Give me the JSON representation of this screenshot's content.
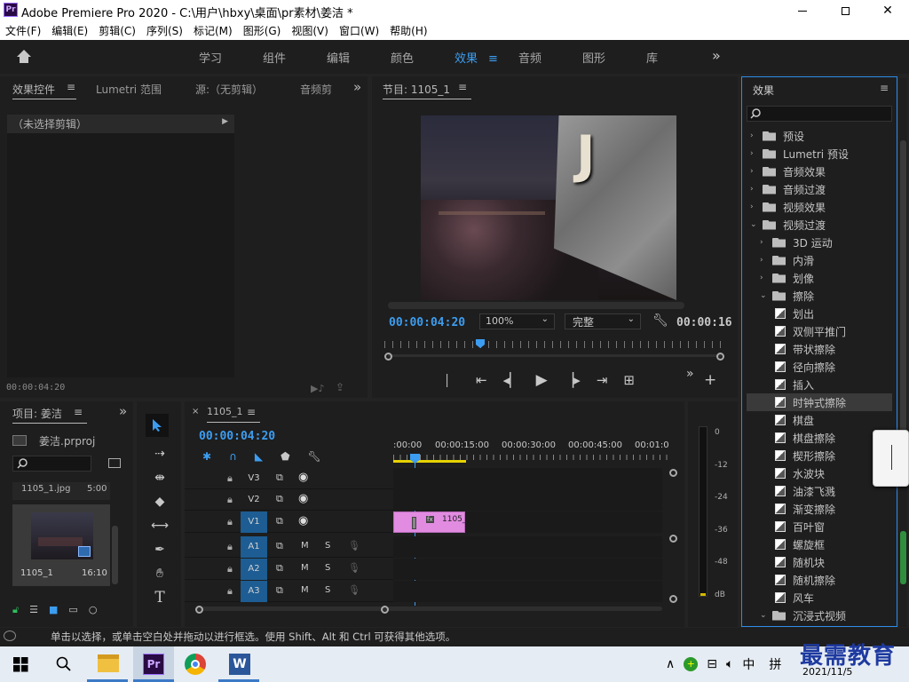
{
  "app": {
    "title": "Adobe Premiere Pro 2020 - C:\\用户\\hbxy\\桌面\\pr素材\\姜洁 *",
    "icon": "Pr"
  },
  "menu": [
    "文件(F)",
    "编辑(E)",
    "剪辑(C)",
    "序列(S)",
    "标记(M)",
    "图形(G)",
    "视图(V)",
    "窗口(W)",
    "帮助(H)"
  ],
  "workspaces": [
    "学习",
    "组件",
    "编辑",
    "颜色",
    "效果",
    "音频",
    "图形",
    "库"
  ],
  "workspace_active": "效果",
  "source": {
    "tabs": [
      "效果控件",
      "Lumetri 范围",
      "源:（无剪辑）",
      "音频剪"
    ],
    "no_clip": "（未选择剪辑）",
    "timecode": "00:00:04:20"
  },
  "program": {
    "title": "节目: 1105_1",
    "timecode": "00:00:04:20",
    "zoom": "100%",
    "quality": "完整",
    "duration": "00:00:16",
    "letter": "J"
  },
  "project": {
    "title": "项目: 姜洁",
    "file": "姜洁.prproj",
    "clip_name": "1105_1.jpg",
    "clip_dur": "5:00",
    "seq_name": "1105_1",
    "seq_dur": "16:10"
  },
  "timeline": {
    "tab": "1105_1",
    "timecode": "00:00:04:20",
    "ruler": [
      ":00:00",
      "00:00:15:00",
      "00:00:30:00",
      "00:00:45:00",
      "00:01:0"
    ],
    "tracks": [
      {
        "name": "V3",
        "kind": "video"
      },
      {
        "name": "V2",
        "kind": "video"
      },
      {
        "name": "V1",
        "kind": "video"
      },
      {
        "name": "A1",
        "kind": "audio"
      },
      {
        "name": "A2",
        "kind": "audio"
      },
      {
        "name": "A3",
        "kind": "audio"
      }
    ],
    "clip": "1105_",
    "clip_fx": "fx",
    "audio_mute": "M",
    "audio_solo": "S"
  },
  "meter": {
    "ticks": [
      "0",
      "-12",
      "-24",
      "-36",
      "-48",
      "dB"
    ]
  },
  "effects": {
    "title": "效果",
    "items": [
      {
        "label": "预设",
        "type": "folder",
        "level": 0,
        "open": false
      },
      {
        "label": "Lumetri 预设",
        "type": "folder",
        "level": 0,
        "open": false
      },
      {
        "label": "音频效果",
        "type": "folder",
        "level": 0,
        "open": false
      },
      {
        "label": "音频过渡",
        "type": "folder",
        "level": 0,
        "open": false
      },
      {
        "label": "视频效果",
        "type": "folder",
        "level": 0,
        "open": false
      },
      {
        "label": "视频过渡",
        "type": "folder",
        "level": 0,
        "open": true
      },
      {
        "label": "3D 运动",
        "type": "folder",
        "level": 1,
        "open": false
      },
      {
        "label": "内滑",
        "type": "folder",
        "level": 1,
        "open": false
      },
      {
        "label": "划像",
        "type": "folder",
        "level": 1,
        "open": false
      },
      {
        "label": "擦除",
        "type": "folder",
        "level": 1,
        "open": true
      },
      {
        "label": "划出",
        "type": "item",
        "level": 2
      },
      {
        "label": "双侧平推门",
        "type": "item",
        "level": 2
      },
      {
        "label": "带状擦除",
        "type": "item",
        "level": 2
      },
      {
        "label": "径向擦除",
        "type": "item",
        "level": 2
      },
      {
        "label": "插入",
        "type": "item",
        "level": 2
      },
      {
        "label": "时钟式擦除",
        "type": "item",
        "level": 2,
        "selected": true
      },
      {
        "label": "棋盘",
        "type": "item",
        "level": 2
      },
      {
        "label": "棋盘擦除",
        "type": "item",
        "level": 2
      },
      {
        "label": "楔形擦除",
        "type": "item",
        "level": 2
      },
      {
        "label": "水波块",
        "type": "item",
        "level": 2
      },
      {
        "label": "油漆飞溅",
        "type": "item",
        "level": 2
      },
      {
        "label": "渐变擦除",
        "type": "item",
        "level": 2
      },
      {
        "label": "百叶窗",
        "type": "item",
        "level": 2
      },
      {
        "label": "螺旋框",
        "type": "item",
        "level": 2
      },
      {
        "label": "随机块",
        "type": "item",
        "level": 2
      },
      {
        "label": "随机擦除",
        "type": "item",
        "level": 2
      },
      {
        "label": "风车",
        "type": "item",
        "level": 2
      },
      {
        "label": "沉浸式视频",
        "type": "folder",
        "level": 1,
        "open": true
      }
    ]
  },
  "status": "单击以选择，或单击空白处并拖动以进行框选。使用 Shift、Alt 和 Ctrl 可获得其他选项。",
  "taskbar": {
    "ime": "中",
    "ime2": "拼",
    "date": "2021/11/5",
    "watermark": "最需教育"
  }
}
